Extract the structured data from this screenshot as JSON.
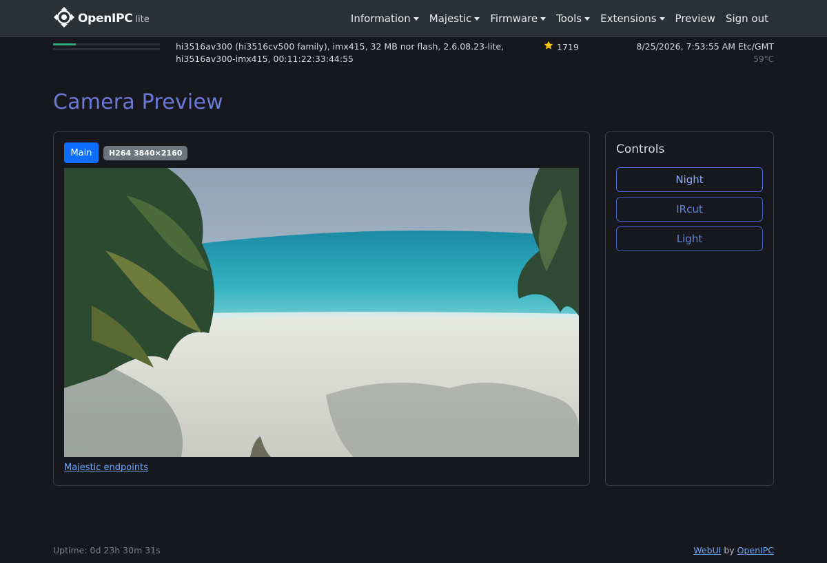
{
  "brand": {
    "name": "OpenIPC",
    "sub": "lite",
    "logo_icon": "openipc-logo-icon"
  },
  "nav": {
    "items": [
      {
        "label": "Information",
        "dropdown": true
      },
      {
        "label": "Majestic",
        "dropdown": true
      },
      {
        "label": "Firmware",
        "dropdown": true
      },
      {
        "label": "Tools",
        "dropdown": true
      },
      {
        "label": "Extensions",
        "dropdown": true
      },
      {
        "label": "Preview",
        "dropdown": false
      },
      {
        "label": "Sign out",
        "dropdown": false
      }
    ]
  },
  "status": {
    "progress_1": 0.21,
    "progress_2": 0.0,
    "sysinfo": "hi3516av300 (hi3516cv500 family), imx415, 32 MB nor flash, 2.6.08.23-lite, hi3516av300-imx415, 00:11:22:33:44:55",
    "stars_icon": "star-icon",
    "stars": "1719",
    "datetime": "8/25/2026, 7:53:55 AM Etc/GMT",
    "temperature": "59°C"
  },
  "page": {
    "title": "Camera Preview"
  },
  "preview": {
    "stream_button": "Main",
    "badge": "H264 3840×2160",
    "endpoints_link": "Majestic endpoints"
  },
  "controls": {
    "title": "Controls",
    "buttons": [
      "Night",
      "IRcut",
      "Light"
    ]
  },
  "footer": {
    "uptime": "Uptime: 0d 23h 30m 31s",
    "webui": "WebUI",
    "by": "by",
    "openipc": "OpenIPC"
  },
  "colors": {
    "accent": "#0d6efd",
    "title": "#6b79d8",
    "progress": "#2fa87a",
    "control_border": "#3d63c7"
  }
}
